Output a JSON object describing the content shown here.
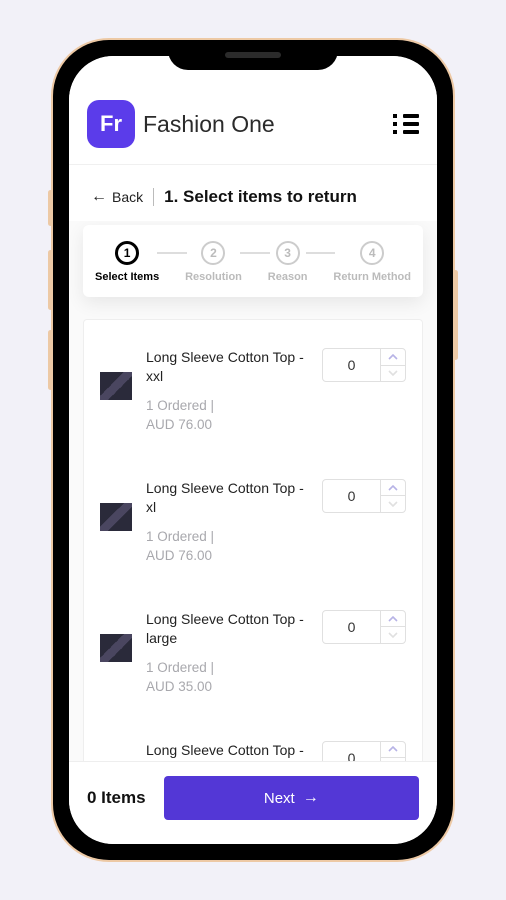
{
  "header": {
    "logo_text": "Fr",
    "brand": "Fashion One"
  },
  "nav": {
    "back_label": "Back",
    "title": "1. Select items to return"
  },
  "stepper": {
    "steps": [
      {
        "num": "1",
        "label": "Select Items",
        "active": true
      },
      {
        "num": "2",
        "label": "Resolution",
        "active": false
      },
      {
        "num": "3",
        "label": "Reason",
        "active": false
      },
      {
        "num": "4",
        "label": "Return Method",
        "active": false
      }
    ]
  },
  "items": [
    {
      "name": "Long Sleeve Cotton Top - xxl",
      "meta_line1": "1 Ordered  |",
      "meta_line2": "AUD 76.00",
      "qty": "0"
    },
    {
      "name": "Long Sleeve Cotton Top - xl",
      "meta_line1": "1 Ordered  |",
      "meta_line2": "AUD 76.00",
      "qty": "0"
    },
    {
      "name": "Long Sleeve Cotton Top - large",
      "meta_line1": "1 Ordered  |",
      "meta_line2": "AUD 35.00",
      "qty": "0"
    },
    {
      "name": "Long Sleeve Cotton Top -",
      "meta_line1": "",
      "meta_line2": "",
      "qty": "0"
    }
  ],
  "footer": {
    "count_label": "0 Items",
    "next_label": "Next"
  },
  "colors": {
    "accent": "#5337d6",
    "logo": "#5b3cea"
  }
}
